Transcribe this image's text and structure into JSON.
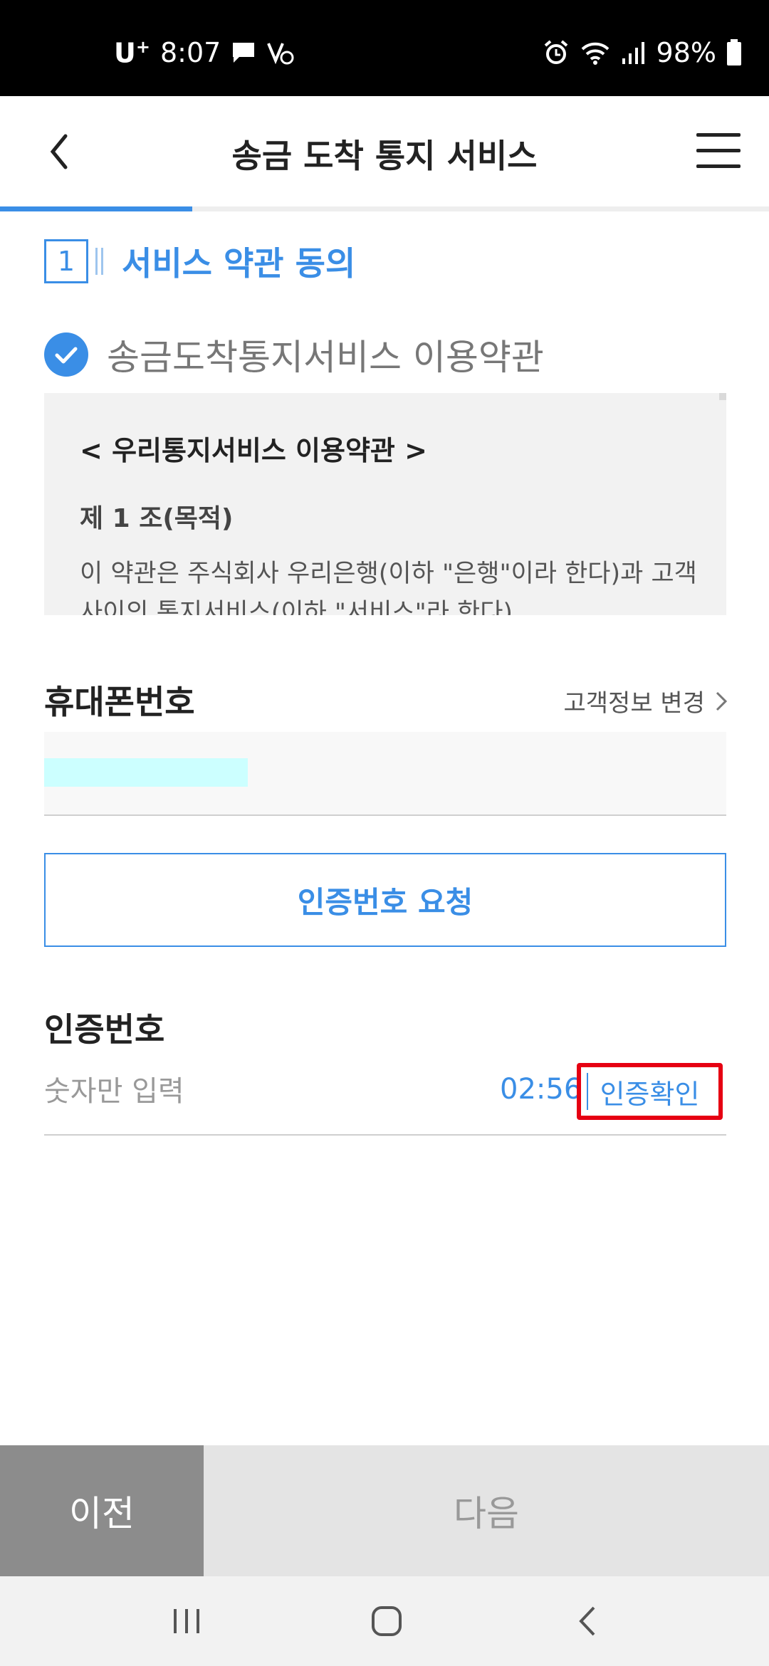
{
  "status_bar": {
    "carrier": "U",
    "carrier_sup": "+",
    "time": "8:07",
    "battery": "98%"
  },
  "header": {
    "title": "송금 도착 통지 서비스",
    "progress": 0.25
  },
  "step": {
    "number": "1",
    "title": "서비스 약관 동의"
  },
  "terms": {
    "title": "송금도착통지서비스 이용약관",
    "heading": "< 우리통지서비스 이용약관 >",
    "article": "제 1 조(목적)",
    "body": "이 약관은 주식회사 우리은행(이하 \"은행\"이라 한다)과 고객 사이의 통지서비스(이하 \"서비스\"라 한다)"
  },
  "phone": {
    "label": "휴대폰번호",
    "change_link": "고객정보 변경"
  },
  "request_button": "인증번호 요청",
  "auth": {
    "label": "인증번호",
    "placeholder": "숫자만 입력",
    "timer": "02:56",
    "verify_button": "인증확인"
  },
  "bottom": {
    "prev": "이전",
    "next": "다음"
  },
  "colors": {
    "accent": "#3a8ee6",
    "highlight": "#e60012"
  }
}
